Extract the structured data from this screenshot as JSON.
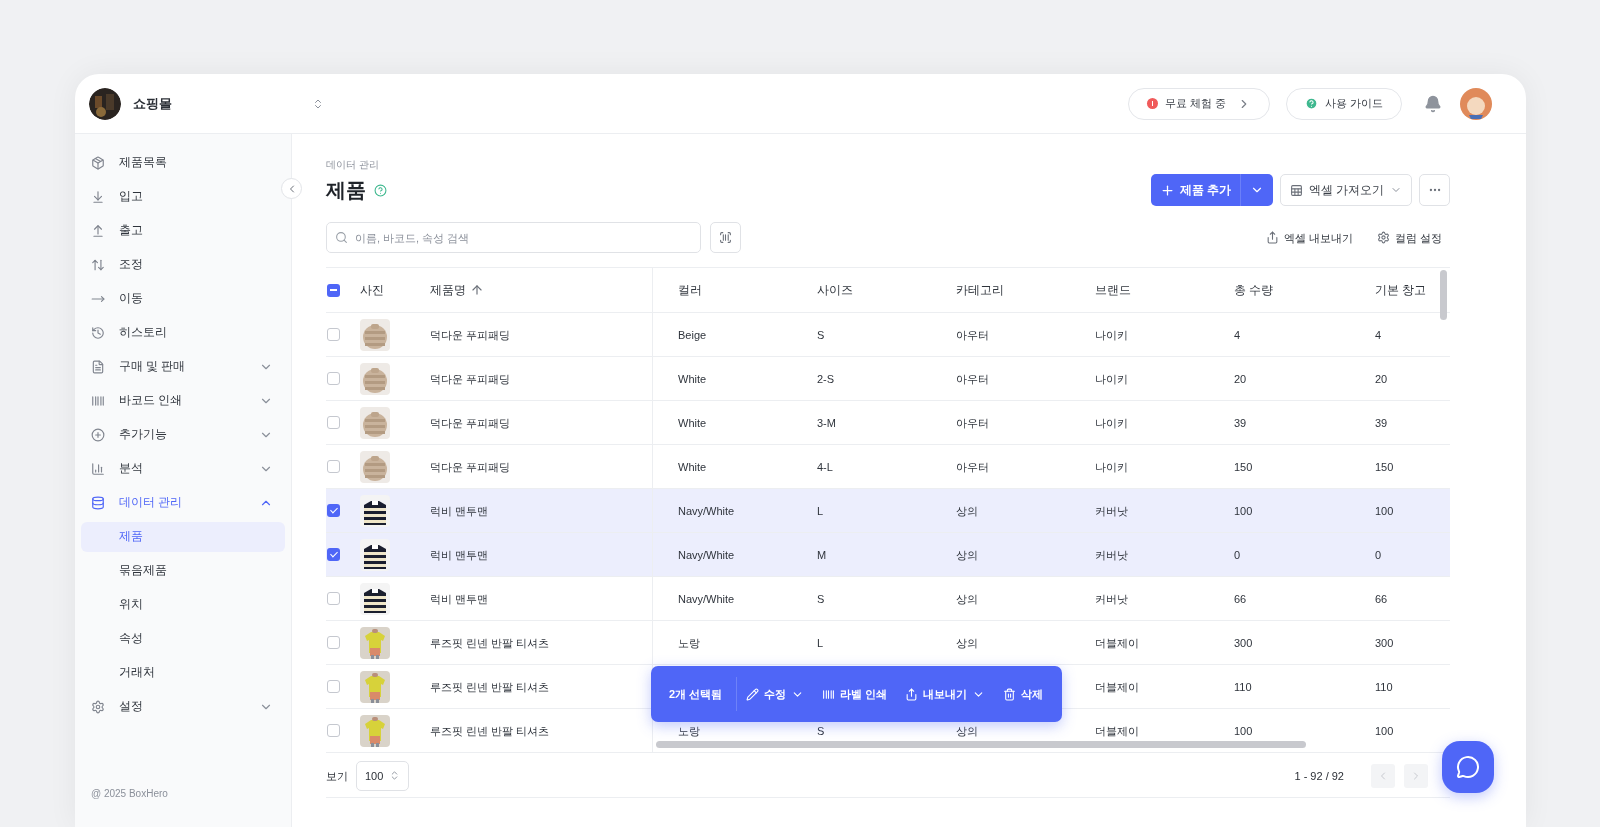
{
  "store": {
    "name": "쇼핑몰"
  },
  "header": {
    "trial": "무료 체험 중",
    "guide": "사용 가이드"
  },
  "sidebar": {
    "items": [
      {
        "label": "제품목록",
        "active": false
      },
      {
        "label": "입고",
        "active": false
      },
      {
        "label": "출고",
        "active": false
      },
      {
        "label": "조정",
        "active": false
      },
      {
        "label": "이동",
        "active": false
      },
      {
        "label": "히스토리",
        "active": false
      },
      {
        "label": "구매 및 판매",
        "active": false,
        "expanded": false
      },
      {
        "label": "바코드 인쇄",
        "active": false,
        "expanded": false
      },
      {
        "label": "추가기능",
        "active": false,
        "expanded": false
      },
      {
        "label": "분석",
        "active": false,
        "expanded": false
      },
      {
        "label": "데이터 관리",
        "active": true,
        "expanded": true,
        "children": [
          {
            "label": "제품",
            "selected": true
          },
          {
            "label": "묶음제품",
            "selected": false
          },
          {
            "label": "위치",
            "selected": false
          },
          {
            "label": "속성",
            "selected": false
          },
          {
            "label": "거래처",
            "selected": false
          }
        ]
      },
      {
        "label": "설정",
        "active": false,
        "expanded": false
      }
    ],
    "footer": "@ 2025 BoxHero"
  },
  "page": {
    "breadcrumb": "데이터 관리",
    "title": "제품"
  },
  "toolbar": {
    "add": "제품 추가",
    "import": "엑셀 가져오기",
    "export": "엑셀 내보내기",
    "columns": "컬럼 설정"
  },
  "search": {
    "placeholder": "이름, 바코드, 속성 검색"
  },
  "table": {
    "select_all_checked": true,
    "select_all_partial": true,
    "sorted_ascending": true,
    "columns": [
      "사진",
      "제품명",
      "컬러",
      "사이즈",
      "카테고리",
      "브랜드",
      "총 수량",
      "기본 창고"
    ],
    "rows": [
      {
        "selected": false,
        "name": "덕다운 푸피패딩",
        "variant_color": "Beige",
        "size": "S",
        "category": "아우터",
        "brand": "나이키",
        "total": "4",
        "warehouse": "4"
      },
      {
        "selected": false,
        "name": "덕다운 푸피패딩",
        "variant_color": "White",
        "size": "2-S",
        "category": "아우터",
        "brand": "나이키",
        "total": "20",
        "warehouse": "20"
      },
      {
        "selected": false,
        "name": "덕다운 푸피패딩",
        "variant_color": "White",
        "size": "3-M",
        "category": "아우터",
        "brand": "나이키",
        "total": "39",
        "warehouse": "39"
      },
      {
        "selected": false,
        "name": "덕다운 푸피패딩",
        "variant_color": "White",
        "size": "4-L",
        "category": "아우터",
        "brand": "나이키",
        "total": "150",
        "warehouse": "150"
      },
      {
        "selected": true,
        "name": "럭비 맨투맨",
        "variant_color": "Navy/White",
        "size": "L",
        "category": "상의",
        "brand": "커버낫",
        "total": "100",
        "warehouse": "100"
      },
      {
        "selected": true,
        "name": "럭비 맨투맨",
        "variant_color": "Navy/White",
        "size": "M",
        "category": "상의",
        "brand": "커버낫",
        "total": "0",
        "warehouse": "0"
      },
      {
        "selected": false,
        "name": "럭비 맨투맨",
        "variant_color": "Navy/White",
        "size": "S",
        "category": "상의",
        "brand": "커버낫",
        "total": "66",
        "warehouse": "66"
      },
      {
        "selected": false,
        "name": "루즈핏 린넨 반팔 티셔츠",
        "variant_color": "노랑",
        "size": "L",
        "category": "상의",
        "brand": "더블제이",
        "total": "300",
        "warehouse": "300"
      },
      {
        "selected": false,
        "name": "루즈핏 린넨 반팔 티셔츠",
        "brand": "더블제이",
        "total": "110",
        "warehouse": "110"
      },
      {
        "selected": false,
        "name": "루즈핏 린넨 반팔 티셔츠",
        "variant_color": "노랑",
        "size": "S",
        "category": "상의",
        "brand": "더블제이",
        "total": "100",
        "warehouse": "100"
      }
    ]
  },
  "bulk_bar": {
    "count": "2개 선택됨",
    "actions": [
      {
        "kind": "edit",
        "label": "수정",
        "has_menu": true
      },
      {
        "kind": "label",
        "label": "라벨 인쇄",
        "has_menu": false
      },
      {
        "kind": "export",
        "label": "내보내기",
        "has_menu": true
      },
      {
        "kind": "delete",
        "label": "삭제",
        "has_menu": false
      }
    ]
  },
  "pagination": {
    "per_page_label": "보기",
    "per_page": "100",
    "range": "1 - 92 / 92",
    "prev_disabled": true,
    "next_disabled": true
  }
}
